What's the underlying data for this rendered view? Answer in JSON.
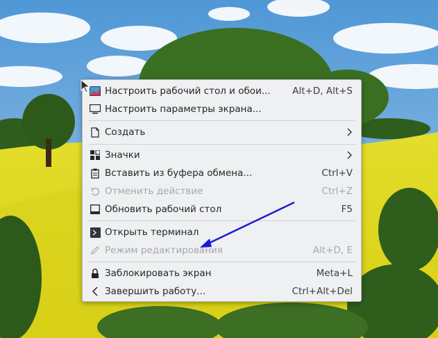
{
  "menu": {
    "items": [
      {
        "label": "Настроить рабочий стол и обои...",
        "shortcut": "Alt+D, Alt+S",
        "icon": "wallpaper-settings-icon",
        "disabled": false
      },
      {
        "label": "Настроить параметры экрана...",
        "shortcut": "",
        "icon": "display-icon",
        "disabled": false
      },
      {
        "label": "Создать",
        "shortcut": "",
        "icon": "new-document-icon",
        "disabled": false,
        "submenu": true
      },
      {
        "label": "Значки",
        "shortcut": "",
        "icon": "icons-grid-icon",
        "disabled": false,
        "submenu": true
      },
      {
        "label": "Вставить из буфера обмена...",
        "shortcut": "Ctrl+V",
        "icon": "clipboard-icon",
        "disabled": false
      },
      {
        "label": "Отменить действие",
        "shortcut": "Ctrl+Z",
        "icon": "undo-icon",
        "disabled": true
      },
      {
        "label": "Обновить рабочий стол",
        "shortcut": "F5",
        "icon": "refresh-desktop-icon",
        "disabled": false
      },
      {
        "label": "Открыть терминал",
        "shortcut": "",
        "icon": "terminal-icon",
        "disabled": false
      },
      {
        "label": "Режим редактирования",
        "shortcut": "Alt+D, E",
        "icon": "edit-pencil-icon",
        "disabled": true
      },
      {
        "label": "Заблокировать экран",
        "shortcut": "Meta+L",
        "icon": "lock-icon",
        "disabled": false
      },
      {
        "label": "Завершить работу...",
        "shortcut": "Ctrl+Alt+Del",
        "icon": "logout-icon",
        "disabled": false
      }
    ]
  },
  "colors": {
    "menu_bg": "#eff0f1",
    "text": "#232627",
    "disabled_text": "#a5a8aa",
    "annotation_arrow": "#1a1ad6"
  }
}
